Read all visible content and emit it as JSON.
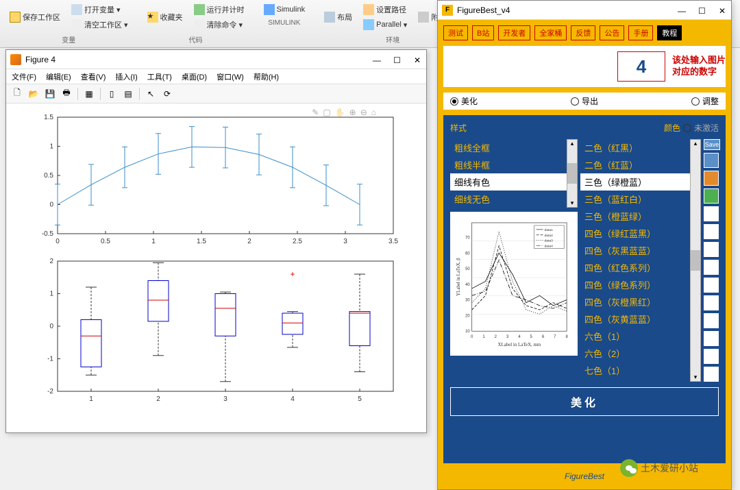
{
  "matlab": {
    "ribbon": {
      "groups": [
        {
          "label": "变量",
          "items": [
            "保存工作区",
            "打开变量",
            "清空工作区"
          ]
        },
        {
          "label": "代码",
          "items": [
            "收藏夹",
            "运行并计时",
            "清除命令"
          ]
        },
        {
          "label": "SIMULINK",
          "items": [
            "Simulink"
          ]
        },
        {
          "label": "环境",
          "items": [
            "布局",
            "设置路径",
            "Parallel",
            "附加功能"
          ]
        }
      ]
    }
  },
  "figure": {
    "title": "Figure 4",
    "menus": [
      "文件(F)",
      "编辑(E)",
      "查看(V)",
      "插入(I)",
      "工具(T)",
      "桌面(D)",
      "窗口(W)",
      "帮助(H)"
    ]
  },
  "chart_data": [
    {
      "type": "line",
      "subtype": "errorbar",
      "x": [
        0,
        0.35,
        0.7,
        1.05,
        1.4,
        1.75,
        2.1,
        2.45,
        2.8,
        3.15
      ],
      "y": [
        0.0,
        0.34,
        0.64,
        0.87,
        0.99,
        0.98,
        0.86,
        0.64,
        0.33,
        0.0
      ],
      "yerr": [
        0.35,
        0.35,
        0.35,
        0.35,
        0.35,
        0.35,
        0.35,
        0.35,
        0.35,
        0.35
      ],
      "xlim": [
        0,
        3.5
      ],
      "ylim": [
        -0.5,
        1.5
      ],
      "xticks": [
        0,
        0.5,
        1,
        1.5,
        2,
        2.5,
        3,
        3.5
      ],
      "yticks": [
        -0.5,
        0,
        0.5,
        1,
        1.5
      ]
    },
    {
      "type": "box",
      "categories": [
        "1",
        "2",
        "3",
        "4",
        "5"
      ],
      "boxes": [
        {
          "min": -1.5,
          "q1": -1.25,
          "median": -0.3,
          "q3": 0.2,
          "max": 1.2
        },
        {
          "min": -0.9,
          "q1": 0.15,
          "median": 0.8,
          "q3": 1.4,
          "max": 1.95
        },
        {
          "min": -1.7,
          "q1": -0.3,
          "median": 0.55,
          "q3": 1.0,
          "max": 1.05
        },
        {
          "min": -0.65,
          "q1": -0.25,
          "median": 0.1,
          "q3": 0.4,
          "max": 0.45,
          "outliers": [
            1.6
          ]
        },
        {
          "min": -1.4,
          "q1": -0.6,
          "median": 0.4,
          "q3": 0.45,
          "max": 1.6
        }
      ],
      "xlim": [
        0.5,
        5.5
      ],
      "ylim": [
        -2,
        2
      ],
      "yticks": [
        -2,
        -1,
        0,
        1,
        2
      ]
    }
  ],
  "figurebest": {
    "title": "FigureBest_v4",
    "tabs": [
      "测试",
      "B站",
      "开发者",
      "全家桶",
      "反馈",
      "公告",
      "手册"
    ],
    "tab_dark": "教程",
    "figure_number": "4",
    "hint_line1": "该处输入图片",
    "hint_line2": "对应的数字",
    "modes": [
      "美化",
      "导出",
      "调整"
    ],
    "mode_selected": 0,
    "panel": {
      "style_label": "样式",
      "color_label": "颜色",
      "inactive_label": "未激活",
      "save_label": "Save",
      "style_list": [
        "粗线全框",
        "粗线半框",
        "细线有色",
        "细线无色"
      ],
      "style_selected": 2,
      "color_list": [
        "二色（红黑）",
        "二色（红蓝）",
        "三色（绿橙蓝）",
        "三色（蓝红白）",
        "三色（橙蓝绿）",
        "四色（绿红蓝黑）",
        "四色（灰黑蓝蓝）",
        "四色（红色系列）",
        "四色（绿色系列）",
        "四色（灰橙黑红）",
        "四色（灰黄蓝蓝）",
        "六色（1）",
        "六色（2）",
        "七色（1）"
      ],
      "color_selected": 2,
      "swatches": [
        "#5a8fc7",
        "#e38b2c",
        "#4caf50",
        "#ffffff",
        "#ffffff",
        "#ffffff",
        "#ffffff",
        "#ffffff",
        "#ffffff",
        "#ffffff",
        "#ffffff",
        "#ffffff",
        "#ffffff"
      ],
      "preview": {
        "xlabel": "XLabel in LaTeX, mm",
        "ylabel": "YLabel in LaTeX, β",
        "legend": [
          "data1",
          "data2",
          "data3",
          "data4"
        ]
      }
    },
    "action_button": "美化",
    "footer": "FigureBest",
    "wechat": "土木爱研小站"
  }
}
